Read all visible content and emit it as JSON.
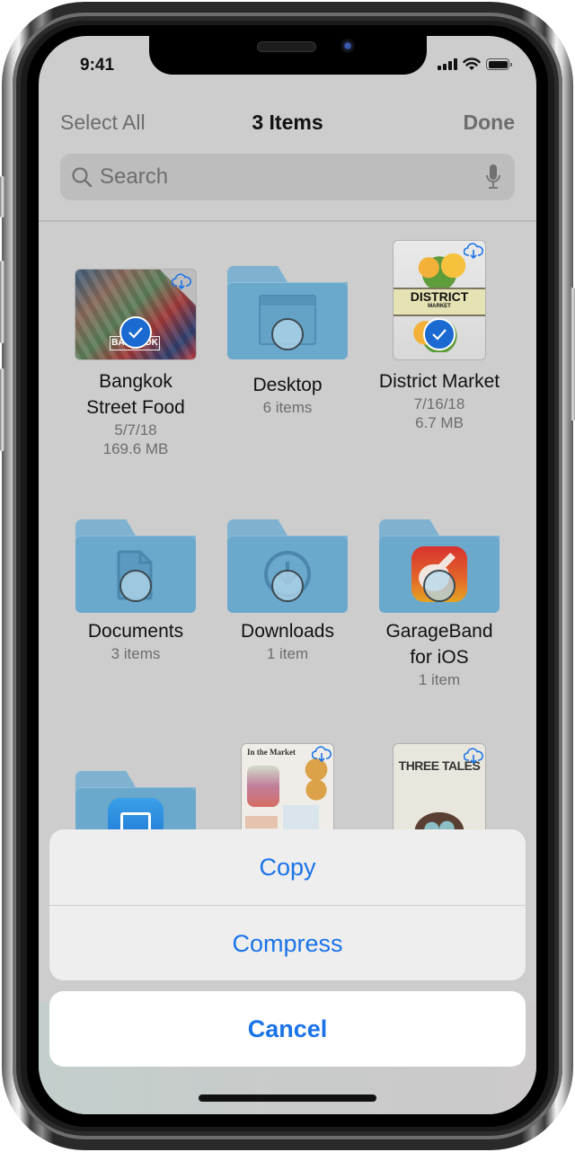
{
  "status_bar": {
    "time": "9:41"
  },
  "nav": {
    "select_all": "Select All",
    "title": "3 Items",
    "done": "Done"
  },
  "search": {
    "placeholder": "Search"
  },
  "items": [
    {
      "name": "Bangkok",
      "name2": "Street Food",
      "meta1": "5/7/18",
      "meta2": "169.6 MB",
      "type": "photo",
      "selected": true,
      "cloud": true,
      "thumb_text": "BANGKOK"
    },
    {
      "name": "Desktop",
      "meta1": "6 items",
      "type": "folder",
      "selected": false
    },
    {
      "name": "District Market",
      "meta1": "7/16/18",
      "meta2": "6.7 MB",
      "type": "document",
      "selected": true,
      "cloud": true,
      "thumb_title": "DISTRICT",
      "thumb_sub": "MARKET"
    },
    {
      "name": "Documents",
      "meta1": "3 items",
      "type": "folder",
      "selected": false
    },
    {
      "name": "Downloads",
      "meta1": "1 item",
      "type": "folder",
      "selected": false
    },
    {
      "name": "GarageBand",
      "name2": "for iOS",
      "meta1": "1 item",
      "type": "app-folder",
      "selected": false
    },
    {
      "name": "",
      "type": "app-folder",
      "selected": false
    },
    {
      "name": "",
      "type": "document",
      "selected": false,
      "cloud": true,
      "thumb_title": "In the Market"
    },
    {
      "name": "",
      "type": "document",
      "selected": true,
      "cloud": true,
      "thumb_title": "THREE TALES"
    }
  ],
  "action_sheet": {
    "copy": "Copy",
    "compress": "Compress",
    "cancel": "Cancel"
  },
  "colors": {
    "accent": "#1a73e8",
    "folder": "#6aa8cc",
    "dimmed_background": "#cdcdcd",
    "check": "#1b6ad1"
  }
}
